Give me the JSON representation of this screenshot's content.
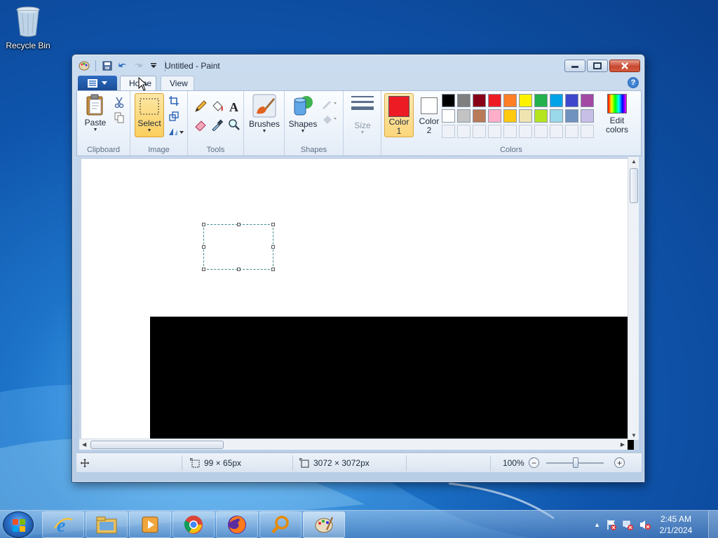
{
  "desktop": {
    "recycle_bin_label": "Recycle Bin"
  },
  "window": {
    "title": "Untitled - Paint"
  },
  "ribbon": {
    "tabs": {
      "home": "Home",
      "view": "View"
    },
    "help": "?",
    "clipboard": {
      "paste": "Paste",
      "group": "Clipboard"
    },
    "image": {
      "select": "Select",
      "group": "Image"
    },
    "tools": {
      "group": "Tools"
    },
    "brushes": {
      "label": "Brushes"
    },
    "shapes": {
      "label": "Shapes",
      "group": "Shapes"
    },
    "size": {
      "label": "Size"
    },
    "colors": {
      "color1_line1": "Color",
      "color1_line2": "1",
      "color2_line1": "Color",
      "color2_line2": "2",
      "edit_line1": "Edit",
      "edit_line2": "colors",
      "group": "Colors",
      "color1": "#ed1c24",
      "color2": "#ffffff",
      "palette_row1": [
        "#000000",
        "#7f7f7f",
        "#880015",
        "#ed1c24",
        "#ff7f27",
        "#fff200",
        "#22b14c",
        "#00a2e8",
        "#3f48cc",
        "#a349a4"
      ],
      "palette_row2": [
        "#ffffff",
        "#c3c3c3",
        "#b97a57",
        "#ffaec9",
        "#ffc90e",
        "#efe4b0",
        "#b5e61d",
        "#99d9ea",
        "#7092be",
        "#c8bfe7"
      ]
    }
  },
  "status": {
    "selection_size": "99 × 65px",
    "image_size": "3072 × 3072px",
    "zoom": "100%",
    "zoom_minus": "−",
    "zoom_plus": "+"
  },
  "taskbar": {
    "time": "2:45 AM",
    "date": "2/1/2024"
  }
}
